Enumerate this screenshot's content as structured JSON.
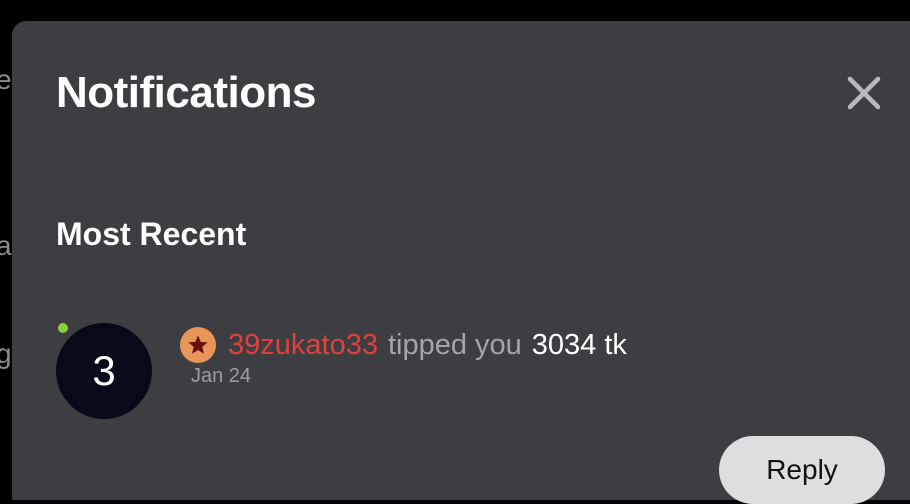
{
  "backdrop": {
    "fragments": [
      "e",
      "a",
      "g"
    ]
  },
  "panel": {
    "title": "Notifications",
    "close_icon": "close-icon"
  },
  "section": {
    "heading": "Most Recent"
  },
  "notifications": [
    {
      "avatar_initial": "3",
      "online": true,
      "badge_icon": "star-icon",
      "username": "39zukato33",
      "action_text": "tipped you",
      "amount": "3034 tk",
      "date": "Jan 24",
      "reply_label": "Reply"
    }
  ],
  "colors": {
    "backdrop": "#000000",
    "panel_bg": "#3d3e42",
    "username": "#e0413b",
    "action_text": "#a4a5a9",
    "badge_bg": "#e8955a",
    "badge_star": "#6a0f0f",
    "online_dot": "#8ad03c",
    "avatar_bg": "#060a19",
    "reply_bg": "#dddedf"
  }
}
